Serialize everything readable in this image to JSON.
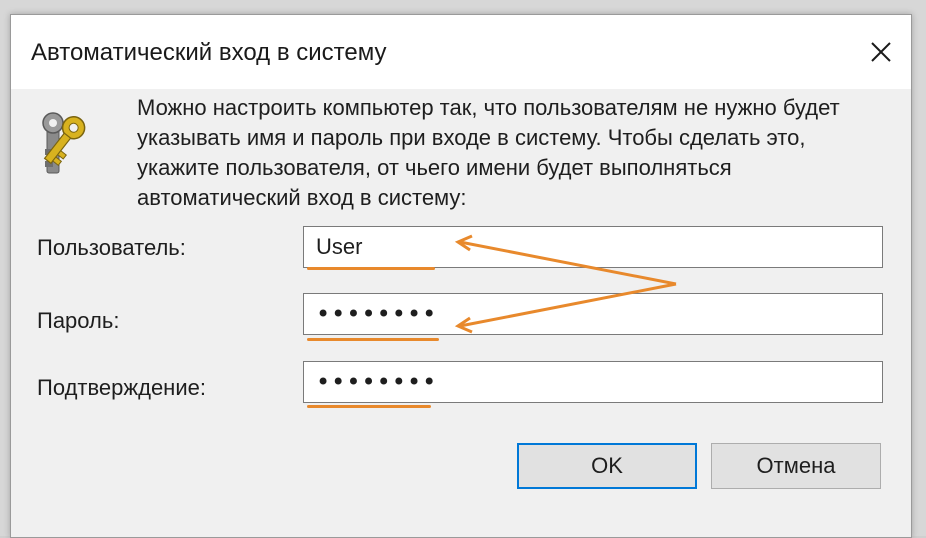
{
  "dialog": {
    "title": "Автоматический вход в систему",
    "close_glyph": "✕",
    "description": "Можно настроить компьютер так, что пользователям не нужно будет указывать имя и пароль при входе в систему. Чтобы сделать это, укажите пользователя, от чьего имени будет выполняться автоматический вход в систему:",
    "icon": "keys-icon"
  },
  "form": {
    "user_label": "Пользователь:",
    "user_value": "User",
    "password_label": "Пароль:",
    "password_value": "••••••••",
    "confirm_label": "Подтверждение:",
    "confirm_value": "••••••••"
  },
  "buttons": {
    "ok_label": "OK",
    "cancel_label": "Отмена"
  },
  "colors": {
    "annotation": "#e8892c",
    "focus": "#0078d7"
  }
}
